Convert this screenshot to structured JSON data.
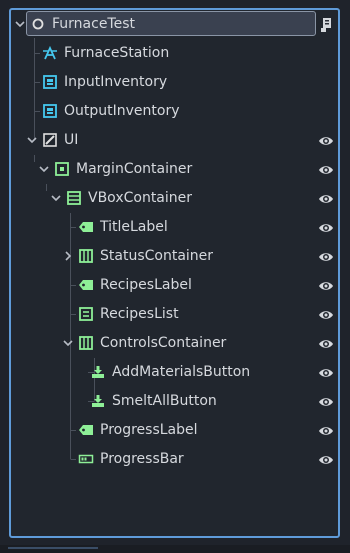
{
  "scene_tree": {
    "root": {
      "label": "FurnaceTest"
    },
    "items": [
      {
        "label": "FurnaceStation"
      },
      {
        "label": "InputInventory"
      },
      {
        "label": "OutputInventory"
      },
      {
        "label": "UI"
      },
      {
        "label": "MarginContainer"
      },
      {
        "label": "VBoxContainer"
      },
      {
        "label": "TitleLabel"
      },
      {
        "label": "StatusContainer"
      },
      {
        "label": "RecipesLabel"
      },
      {
        "label": "RecipesList"
      },
      {
        "label": "ControlsContainer"
      },
      {
        "label": "AddMaterialsButton"
      },
      {
        "label": "SmeltAllButton"
      },
      {
        "label": "ProgressLabel"
      },
      {
        "label": "ProgressBar"
      }
    ]
  },
  "colors": {
    "selection_border": "#5f9bd9",
    "text": "#d6d9de",
    "node2d_blue": "#8da5f3",
    "node3d_cyan": "#45c8ef",
    "control_green": "#8eef97"
  }
}
